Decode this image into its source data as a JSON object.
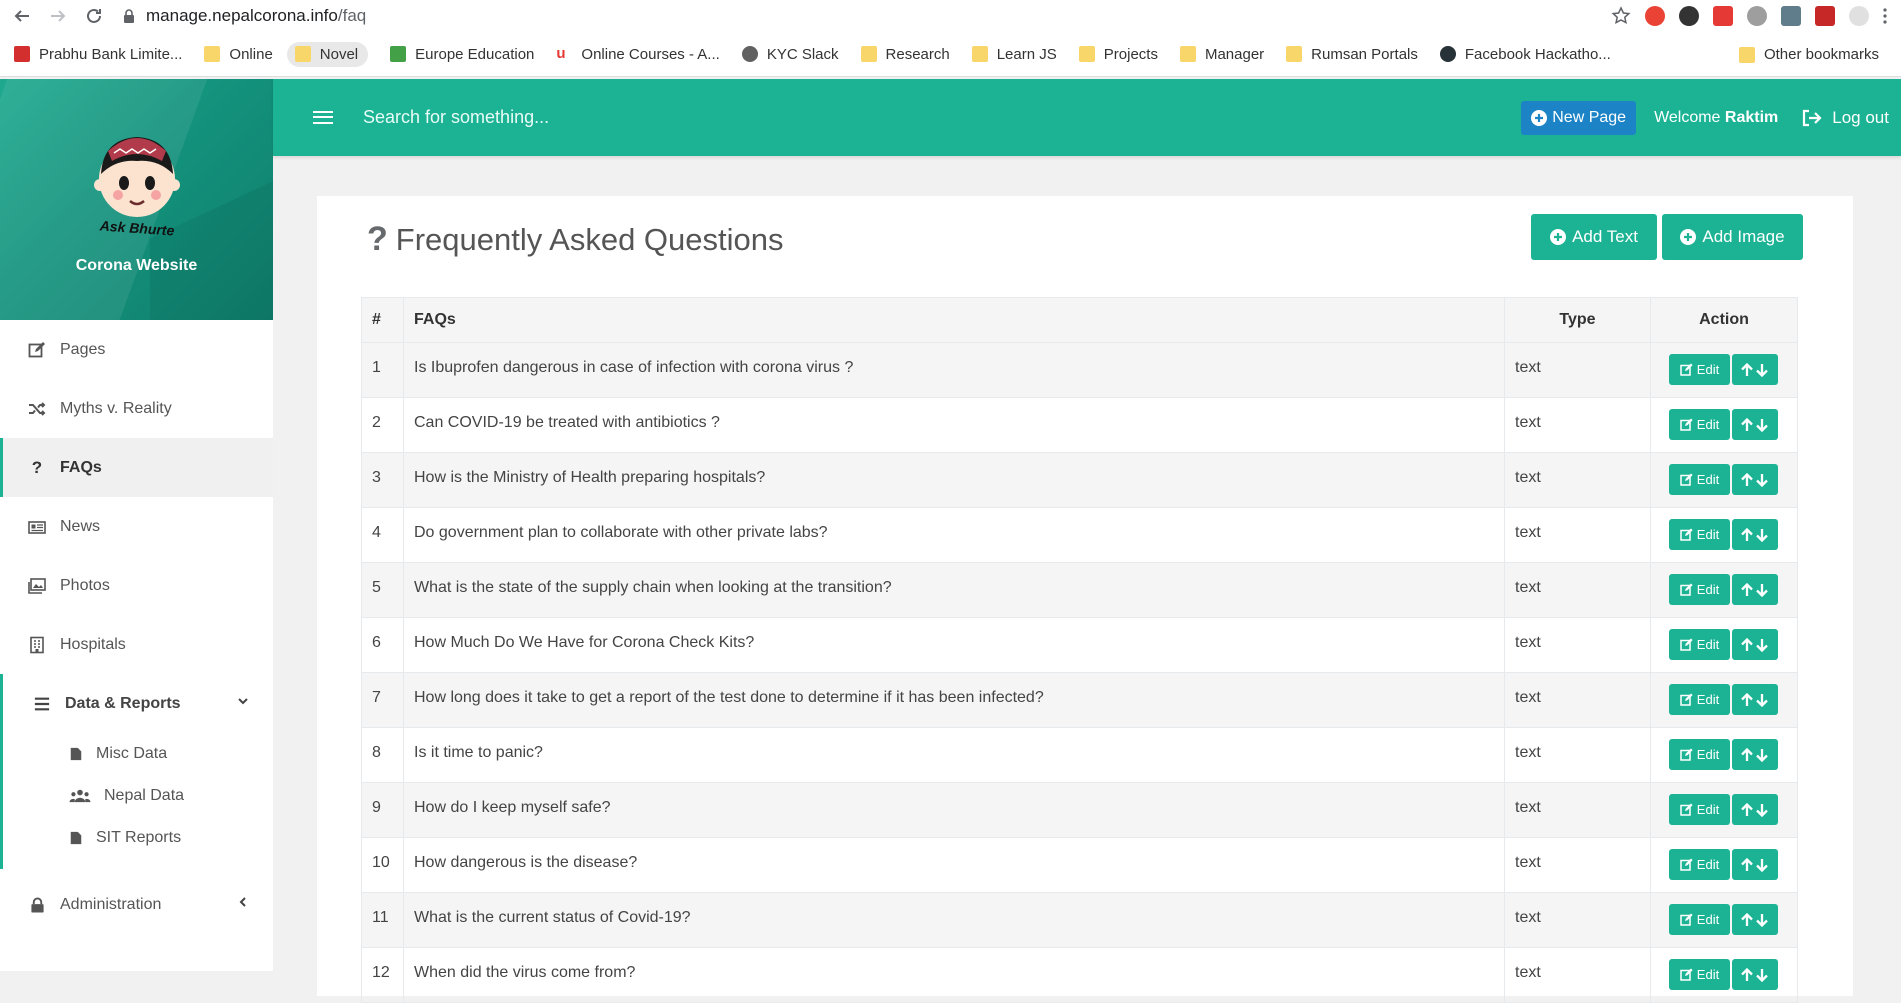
{
  "browser": {
    "url_host": "manage.nepalcorona.info",
    "url_path": "/faq",
    "bookmarks": [
      {
        "label": "Prabhu Bank Limite...",
        "icon": "prabhu-icon"
      },
      {
        "label": "Online",
        "icon": "folder-icon"
      },
      {
        "label": "Novel",
        "icon": "folder-icon"
      },
      {
        "label": "Europe Education",
        "icon": "play-icon"
      },
      {
        "label": "Online Courses - A...",
        "icon": "udemy-icon"
      },
      {
        "label": "KYC Slack",
        "icon": "globe-icon"
      },
      {
        "label": "Research",
        "icon": "folder-icon"
      },
      {
        "label": "Learn JS",
        "icon": "folder-icon"
      },
      {
        "label": "Projects",
        "icon": "folder-icon"
      },
      {
        "label": "Manager",
        "icon": "folder-icon"
      },
      {
        "label": "Rumsan Portals",
        "icon": "folder-icon"
      },
      {
        "label": "Facebook Hackatho...",
        "icon": "d-icon"
      }
    ],
    "other_bookmarks": "Other bookmarks"
  },
  "sidebar": {
    "brand_title": "Corona Website",
    "logo_text": "Ask Bhurte",
    "items": [
      {
        "label": "Pages",
        "icon": "edit-icon"
      },
      {
        "label": "Myths v. Reality",
        "icon": "shuffle-icon"
      },
      {
        "label": "FAQs",
        "icon": "question-icon"
      },
      {
        "label": "News",
        "icon": "newspaper-icon"
      },
      {
        "label": "Photos",
        "icon": "images-icon"
      },
      {
        "label": "Hospitals",
        "icon": "building-icon"
      }
    ],
    "group": {
      "label": "Data & Reports",
      "icon": "bars-icon",
      "children": [
        {
          "label": "Misc Data",
          "icon": "file-icon"
        },
        {
          "label": "Nepal Data",
          "icon": "users-icon"
        },
        {
          "label": "SIT Reports",
          "icon": "file-icon"
        }
      ]
    },
    "admin": {
      "label": "Administration",
      "icon": "lock-icon"
    }
  },
  "header": {
    "search_placeholder": "Search for something...",
    "new_page": "New Page",
    "welcome": "Welcome",
    "user": "Raktim",
    "logout": "Log out"
  },
  "main": {
    "title": "Frequently Asked Questions",
    "add_text": "Add Text",
    "add_image": "Add Image",
    "columns": {
      "num": "#",
      "faq": "FAQs",
      "type": "Type",
      "action": "Action"
    },
    "edit_label": "Edit",
    "rows": [
      {
        "num": "1",
        "faq": "Is Ibuprofen dangerous in case of infection with corona virus ?",
        "type": "text"
      },
      {
        "num": "2",
        "faq": "Can COVID-19 be treated with antibiotics ?",
        "type": "text"
      },
      {
        "num": "3",
        "faq": "How is the Ministry of Health preparing hospitals?",
        "type": "text"
      },
      {
        "num": "4",
        "faq": "Do government plan to collaborate with other private labs?",
        "type": "text"
      },
      {
        "num": "5",
        "faq": "What is the state of the supply chain when looking at the transition?",
        "type": "text"
      },
      {
        "num": "6",
        "faq": "How Much Do We Have for Corona Check Kits?",
        "type": "text"
      },
      {
        "num": "7",
        "faq": "How long does it take to get a report of the test done to determine if it has been infected?",
        "type": "text"
      },
      {
        "num": "8",
        "faq": "Is it time to panic?",
        "type": "text"
      },
      {
        "num": "9",
        "faq": "How do I keep myself safe?",
        "type": "text"
      },
      {
        "num": "10",
        "faq": "How dangerous is the disease?",
        "type": "text"
      },
      {
        "num": "11",
        "faq": "What is the current status of Covid-19?",
        "type": "text"
      },
      {
        "num": "12",
        "faq": "When did the virus come from?",
        "type": "text"
      }
    ]
  },
  "colors": {
    "accent": "#1bb394",
    "primary_button": "#1c84c6"
  }
}
